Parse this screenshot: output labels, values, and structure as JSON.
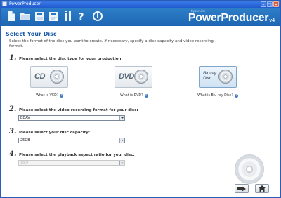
{
  "window": {
    "title": "PowerProducer"
  },
  "toolbar": {
    "buttons": [
      {
        "icon": "new-document-icon"
      },
      {
        "icon": "open-folder-icon"
      },
      {
        "icon": "save-icon"
      },
      {
        "icon": "save-as-icon"
      },
      {
        "icon": "settings-icon"
      },
      {
        "icon": "help-icon"
      },
      {
        "icon": "info-icon"
      }
    ],
    "brand": {
      "cyber_label": "CyberLink",
      "name": "PowerProducer",
      "version": "v4"
    }
  },
  "page": {
    "title": "Select Your Disc",
    "subtitle": "Select the format of the disc you want to create. If necessary, specify a disc capacity and video recording format."
  },
  "steps": [
    {
      "number": "1.",
      "label": "Please select the disc type for your production:"
    },
    {
      "number": "2.",
      "label": "Please select the video recording format for your disc:"
    },
    {
      "number": "3.",
      "label": "Please select your disc capacity:"
    },
    {
      "number": "4.",
      "label": "Please select the playback aspect ratio for your disc:"
    }
  ],
  "disc_types": [
    {
      "logo": "CD",
      "link": "What is VCD?",
      "selected": false
    },
    {
      "logo": "DVD",
      "link": "What is DVD?",
      "selected": false
    },
    {
      "logo": "Blu-ray Disc",
      "link": "What is Blu-ray Disc?",
      "selected": true
    }
  ],
  "selects": {
    "recording_format": {
      "value": "BDAV",
      "enabled": true
    },
    "capacity": {
      "value": "25GB",
      "enabled": true
    },
    "aspect_ratio": {
      "value": "16:9",
      "enabled": false
    }
  },
  "nav": {
    "next_icon": "next-arrow-icon",
    "home_icon": "home-icon"
  },
  "colors": {
    "title_bar": "#2a63d6",
    "toolbar": "#2a77c2",
    "heading": "#1f5ea8"
  }
}
